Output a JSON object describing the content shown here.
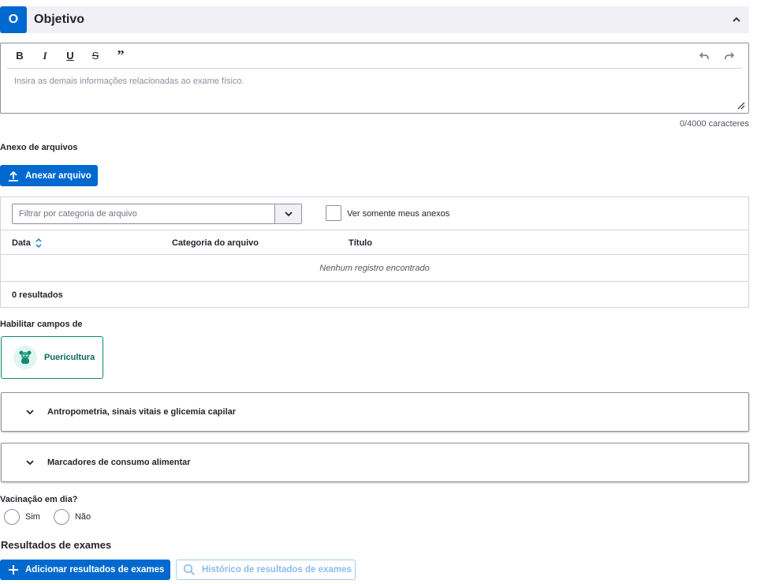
{
  "section": {
    "badge": "O",
    "title": "Objetivo"
  },
  "editor": {
    "toolbar": {
      "bold": "B",
      "italic": "I",
      "underline": "U",
      "strike": "S",
      "quote": "”"
    },
    "placeholder": "Insira as demais informações relacionadas ao exame físico.",
    "char_count": "0/4000 caracteres"
  },
  "attachments": {
    "label": "Anexo de arquivos",
    "attach_button": "Anexar arquivo",
    "filter_placeholder": "Filtrar por categoria de arquivo",
    "checkbox_label": "Ver somente meus anexos",
    "columns": [
      "Data",
      "Categoria do arquivo",
      "Título"
    ],
    "empty_message": "Nenhum registro encontrado",
    "results": "0 resultados"
  },
  "enable_fields": {
    "label": "Habilitar campos de",
    "puericultura": "Puericultura"
  },
  "accordions": [
    {
      "label": "Antropometria, sinais vitais e glicemia capilar"
    },
    {
      "label": "Marcadores de consumo alimentar"
    }
  ],
  "vaccination": {
    "question": "Vacinação em dia?",
    "options": [
      "Sim",
      "Não"
    ]
  },
  "exams": {
    "heading": "Resultados de exames",
    "add_button": "Adicionar resultados de exames",
    "history_button": "Histórico de resultados de exames"
  },
  "colors": {
    "primary": "#0069d0",
    "teal": "#0c8a73",
    "header_bg": "#f0f0f5"
  }
}
